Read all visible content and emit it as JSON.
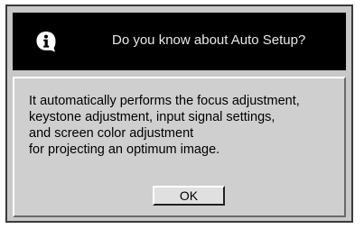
{
  "dialog": {
    "title": "Do you know about Auto Setup?",
    "icon": "info-icon",
    "message_lines": [
      "It automatically performs the focus adjustment,",
      "keystone adjustment, input signal settings,",
      "and screen color adjustment",
      "for projecting an optimum image."
    ],
    "ok_label": "OK"
  },
  "colors": {
    "titlebar": "#000000",
    "title_text": "#e8e8e8",
    "body_bg": "#cfcfcf",
    "frame_bg": "#c8c8c8"
  }
}
